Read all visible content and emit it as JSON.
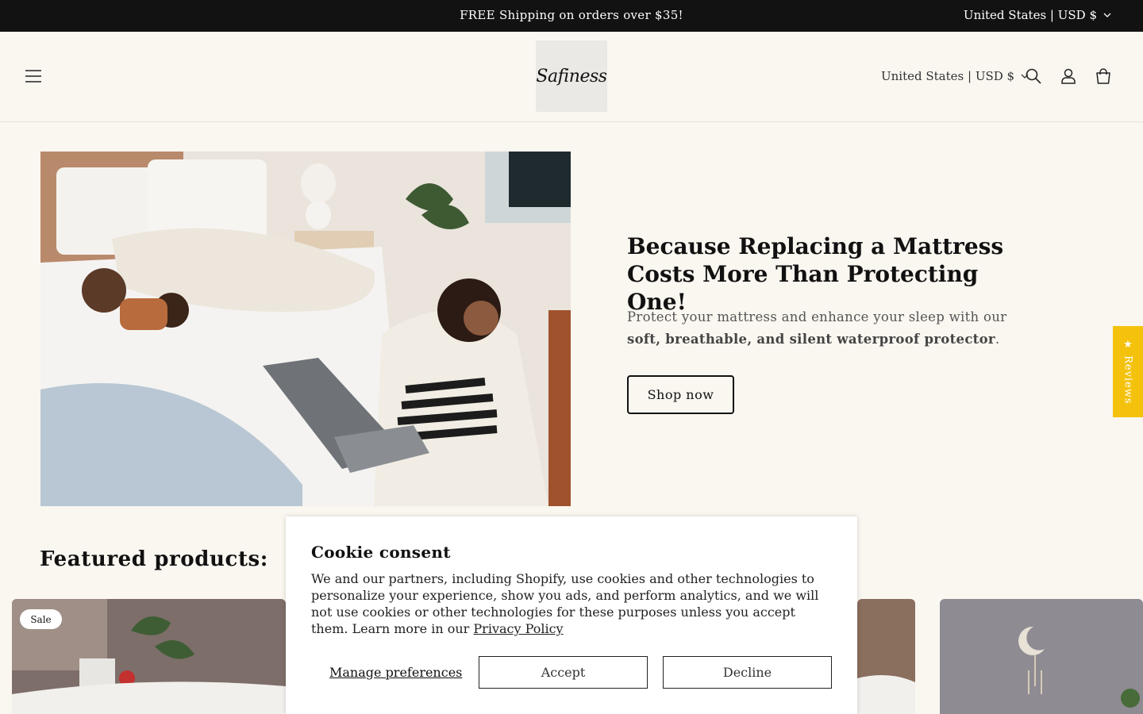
{
  "announcement": {
    "message": "FREE Shipping on orders over $35!",
    "locale": "United States | USD $"
  },
  "header": {
    "logo_text": "Safiness",
    "locale": "United States | USD $",
    "icons": [
      "menu-icon",
      "search-icon",
      "account-icon",
      "cart-icon"
    ]
  },
  "hero": {
    "title": "Because Replacing a Mattress Costs More Than Protecting One!",
    "text_before": "Protect your mattress and enhance your sleep with our ",
    "text_bold": "soft, breathable, and silent waterproof protector",
    "text_after": ".",
    "button_label": "Shop now"
  },
  "reviews_tab": {
    "label": "★ Reviews",
    "color": "#f4c20d"
  },
  "featured": {
    "heading": "Featured products:",
    "sale_badge": "Sale"
  },
  "cookie": {
    "title": "Cookie consent",
    "body": "We and our partners, including Shopify, use cookies and other technologies to personalize your experience, show you ads, and perform analytics, and we will not use cookies or other technologies for these purposes unless you accept them. Learn more in our ",
    "link": "Privacy Policy",
    "manage": "Manage preferences",
    "accept": "Accept",
    "decline": "Decline"
  }
}
